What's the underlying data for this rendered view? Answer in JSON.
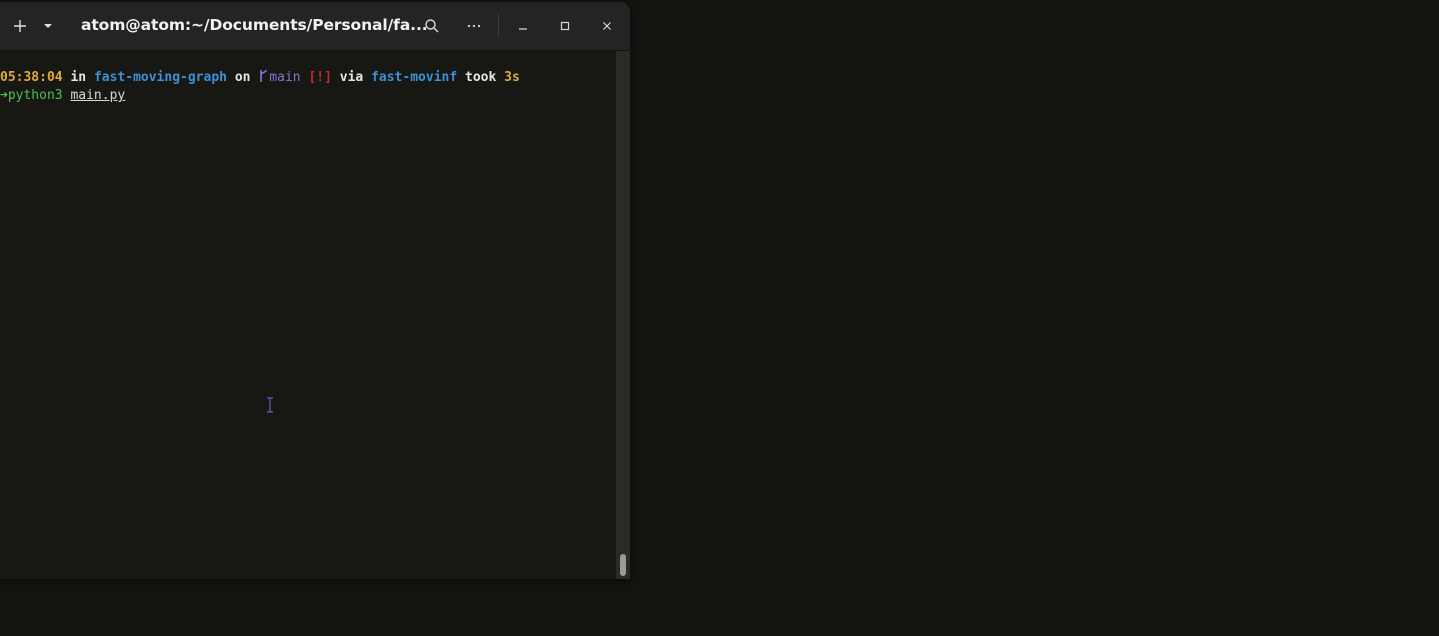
{
  "window": {
    "title": "atom@atom:~/Documents/Personal/fa..."
  },
  "header_icons": {
    "new_tab": "plus-icon",
    "tab_menu": "chevron-down-icon",
    "search": "search-icon",
    "menu": "ellipsis-icon",
    "minimize": "minimize-icon",
    "maximize": "maximize-icon",
    "close": "close-icon"
  },
  "terminal": {
    "prompt": {
      "time": "05:38:04",
      "in_word": "in",
      "directory": "fast-moving-graph",
      "on_word": "on",
      "branch_icon": "",
      "branch": "main",
      "git_status": "[!]",
      "via_word": "via",
      "env": "fast-movinf",
      "took_word": "took",
      "duration": "3s"
    },
    "command_line": {
      "arrow": "➜",
      "command": "python3",
      "argument": "main.py"
    }
  },
  "colors": {
    "background": "#171714",
    "headerbar": "#242424",
    "time": "#e2a937",
    "directory": "#3d8fd6",
    "branch": "#8f6fd6",
    "status": "#c62828",
    "command": "#4fc04f"
  }
}
